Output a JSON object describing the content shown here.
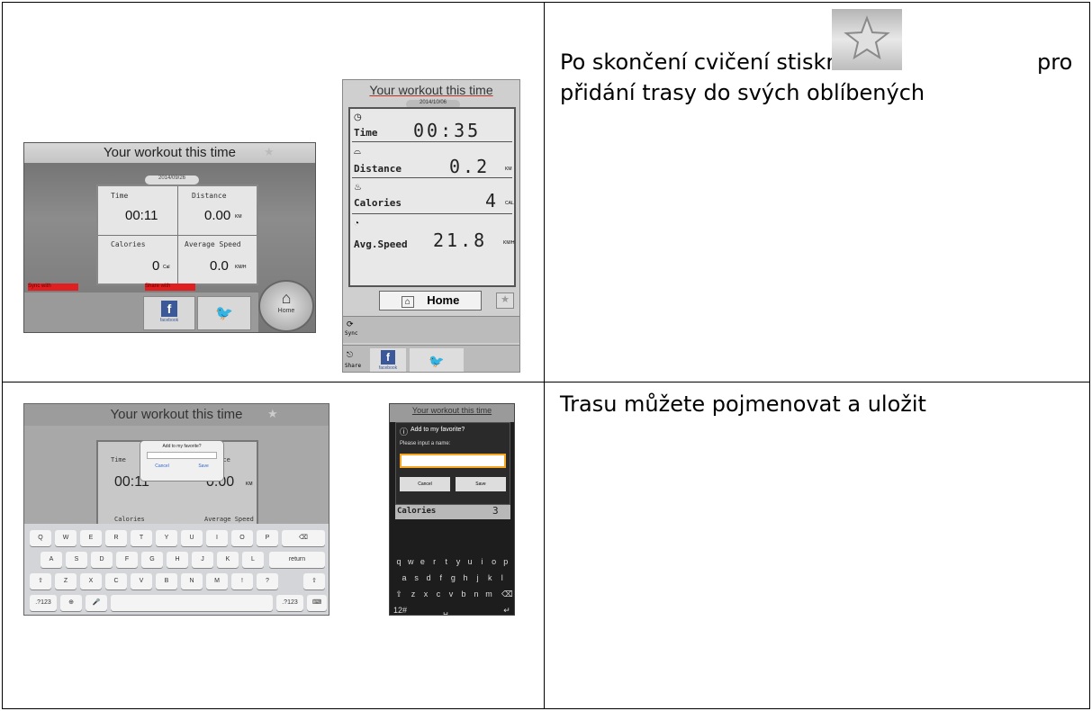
{
  "rows": [
    {
      "description": {
        "part1": "Po skončení cvičení  stiskněte",
        "part2": "pro",
        "line2": "přidání trasy do svých oblíbených"
      },
      "tablet": {
        "title": "Your workout this time",
        "date": "2014/09/26",
        "time_label": "Time",
        "time_value": "00:11",
        "distance_label": "Distance",
        "distance_value": "0.00",
        "distance_unit": "KM",
        "calories_label": "Calories",
        "calories_value": "0",
        "calories_unit": "Cal",
        "speed_label": "Average Speed",
        "speed_value": "0.0",
        "speed_unit": "KM/H",
        "sync_label": "Sync with",
        "share_label": "Share with",
        "facebook_label": "facebook",
        "home_label": "Home"
      },
      "phone": {
        "title": "Your workout this time",
        "date": "2014/10/06",
        "time_label": "Time",
        "time_value": "00:35",
        "distance_label": "Distance",
        "distance_value": "0.2",
        "distance_unit": "KM",
        "calories_label": "Calories",
        "calories_value": "4",
        "calories_unit": "CAL",
        "speed_label": "Avg.Speed",
        "speed_value": "21.8",
        "speed_unit": "KM/H",
        "home_label": "Home",
        "sync_label": "Sync",
        "share_label": "Share",
        "facebook_label": "facebook"
      }
    },
    {
      "description": {
        "text": "Trasu můžete pojmenovat a uložit"
      },
      "tablet": {
        "title": "Your workout this time",
        "dialog_title": "Add to my favorite?",
        "cancel_label": "Cancel",
        "save_label": "Save",
        "time_label": "Time",
        "time_value": "00:11",
        "distance_partial": "ance",
        "distance_value": "0.00",
        "distance_unit": "KM",
        "calories_label": "Calories",
        "speed_label": "Average Speed",
        "keyboard_row1": [
          "Q",
          "W",
          "E",
          "R",
          "T",
          "Y",
          "U",
          "I",
          "O",
          "P"
        ],
        "keyboard_row2": [
          "A",
          "S",
          "D",
          "F",
          "G",
          "H",
          "J",
          "K",
          "L"
        ],
        "keyboard_row3": [
          "Z",
          "X",
          "C",
          "V",
          "B",
          "N",
          "M",
          "!",
          "?"
        ],
        "return_label": "return",
        "num_label": ".?123"
      },
      "phone": {
        "title": "Your workout this time",
        "dialog_title": "Add to my favorite?",
        "dialog_prompt": "Please input a name:",
        "cancel_label": "Cancel",
        "save_label": "Save",
        "calories_label": "Calories",
        "calories_value": "3",
        "keyboard_row1": [
          "q",
          "w",
          "e",
          "r",
          "t",
          "y",
          "u",
          "i",
          "o",
          "p"
        ],
        "keyboard_row2": [
          "a",
          "s",
          "d",
          "f",
          "g",
          "h",
          "j",
          "k",
          "l"
        ],
        "keyboard_row3": [
          "z",
          "x",
          "c",
          "v",
          "b",
          "n",
          "m"
        ],
        "num_label": "12#"
      }
    }
  ]
}
